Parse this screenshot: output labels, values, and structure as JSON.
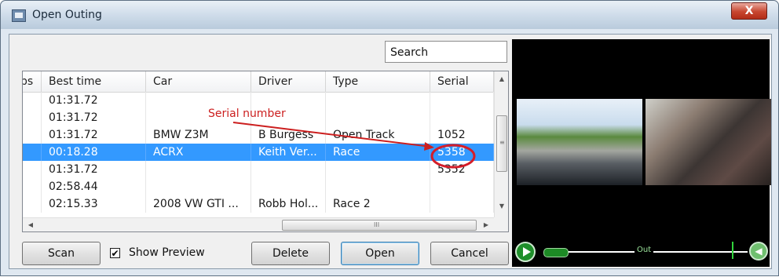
{
  "window": {
    "title": "Open Outing",
    "close_glyph": "X"
  },
  "search": {
    "value": "Search"
  },
  "table": {
    "columns": [
      "ps",
      "Best time",
      "Car",
      "Driver",
      "Type",
      "Serial"
    ],
    "rows": [
      {
        "best_time": "01:31.72",
        "car": "",
        "driver": "",
        "type": "",
        "serial": ""
      },
      {
        "best_time": "01:31.72",
        "car": "",
        "driver": "",
        "type": "",
        "serial": ""
      },
      {
        "best_time": "01:31.72",
        "car": "BMW Z3M",
        "driver": "B Burgess",
        "type": "Open Track",
        "serial": "1052"
      },
      {
        "best_time": "00:18.28",
        "car": "ACRX",
        "driver": "Keith Ver...",
        "type": "Race",
        "serial": "5358"
      },
      {
        "best_time": "01:31.72",
        "car": "",
        "driver": "",
        "type": "",
        "serial": "5352"
      },
      {
        "best_time": "02:58.44",
        "car": "",
        "driver": "",
        "type": "",
        "serial": ""
      },
      {
        "best_time": "02:15.33",
        "car": "2008 VW GTI ...",
        "driver": "Robb Hol...",
        "type": "Race 2",
        "serial": ""
      }
    ],
    "selected_row": 3,
    "hscroll_grip": "III",
    "vscroll_grip": "≡"
  },
  "annotation": {
    "label": "Serial number",
    "color": "#cc1f1f"
  },
  "buttons": {
    "scan": "Scan",
    "show_preview_label": "Show Preview",
    "show_preview_checked": true,
    "delete": "Delete",
    "open": "Open",
    "cancel": "Cancel"
  },
  "player": {
    "out_label": "Out",
    "icons": [
      "play-icon",
      "volume-icon"
    ]
  },
  "colors": {
    "selection": "#3399ff",
    "accent": "#1f8f2b"
  }
}
